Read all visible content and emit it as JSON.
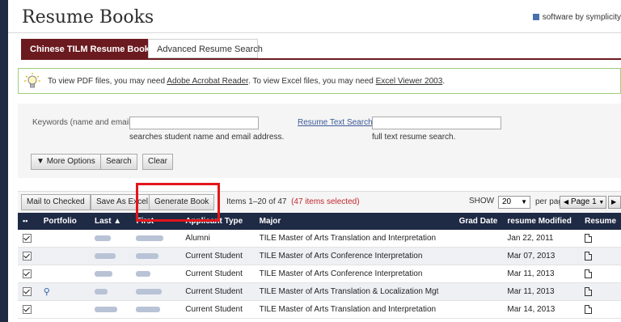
{
  "header": {
    "title": "Resume Books",
    "brand": "software by symplicity"
  },
  "tabs": [
    {
      "label": "Chinese TILM Resume Book",
      "active": true
    },
    {
      "label": "Advanced Resume Search",
      "active": false
    }
  ],
  "info": {
    "prefix": "To view PDF files, you may need ",
    "link1": "Adobe Acrobat Reader",
    "middle": ". To view Excel files, you may need ",
    "link2": "Excel Viewer 2003",
    "suffix": "."
  },
  "search": {
    "keywords_label": "Keywords (name and email)",
    "keywords_value": "",
    "keywords_hint": "searches student name and email address.",
    "resume_text_link": "Resume Text Search",
    "resume_text_value": "",
    "resume_text_hint": "full text resume search.",
    "more_options": "More Options",
    "search_btn": "Search",
    "clear_btn": "Clear"
  },
  "toolbar": {
    "mail": "Mail to Checked",
    "save_excel": "Save As Excel",
    "generate": "Generate Book",
    "items_text": "Items 1–20 of 47",
    "items_selected": "(47 items selected)",
    "show_label": "SHOW",
    "show_value": "20",
    "per_page": "per page",
    "page_label": "Page",
    "page_value": "1"
  },
  "columns": [
    "Portfolio",
    "Last ▲",
    "First",
    "Applicant Type",
    "Major",
    "Grad Date",
    "resume Modified",
    "Resume"
  ],
  "rows": [
    {
      "applicant_type": "Alumni",
      "major": "TILE Master of Arts Translation and Interpretation",
      "modified": "Jan 22, 2011",
      "portfolio": false
    },
    {
      "applicant_type": "Current Student",
      "major": "TILE Master of Arts Conference Interpretation",
      "modified": "Mar 07, 2013",
      "portfolio": false
    },
    {
      "applicant_type": "Current Student",
      "major": "TILE Master of Arts Conference Interpretation",
      "modified": "Mar 11, 2013",
      "portfolio": false
    },
    {
      "applicant_type": "Current Student",
      "major": "TILE Master of Arts Translation & Localization Mgt",
      "modified": "Mar 11, 2013",
      "portfolio": true
    },
    {
      "applicant_type": "Current Student",
      "major": "TILE Master of Arts Translation and Interpretation",
      "modified": "Mar 14, 2013",
      "portfolio": false
    }
  ],
  "colors": {
    "header_bg": "#1f2a44",
    "tab_active": "#6b1a1f",
    "accent_red": "#c0262c",
    "highlight": "#e3151a"
  }
}
